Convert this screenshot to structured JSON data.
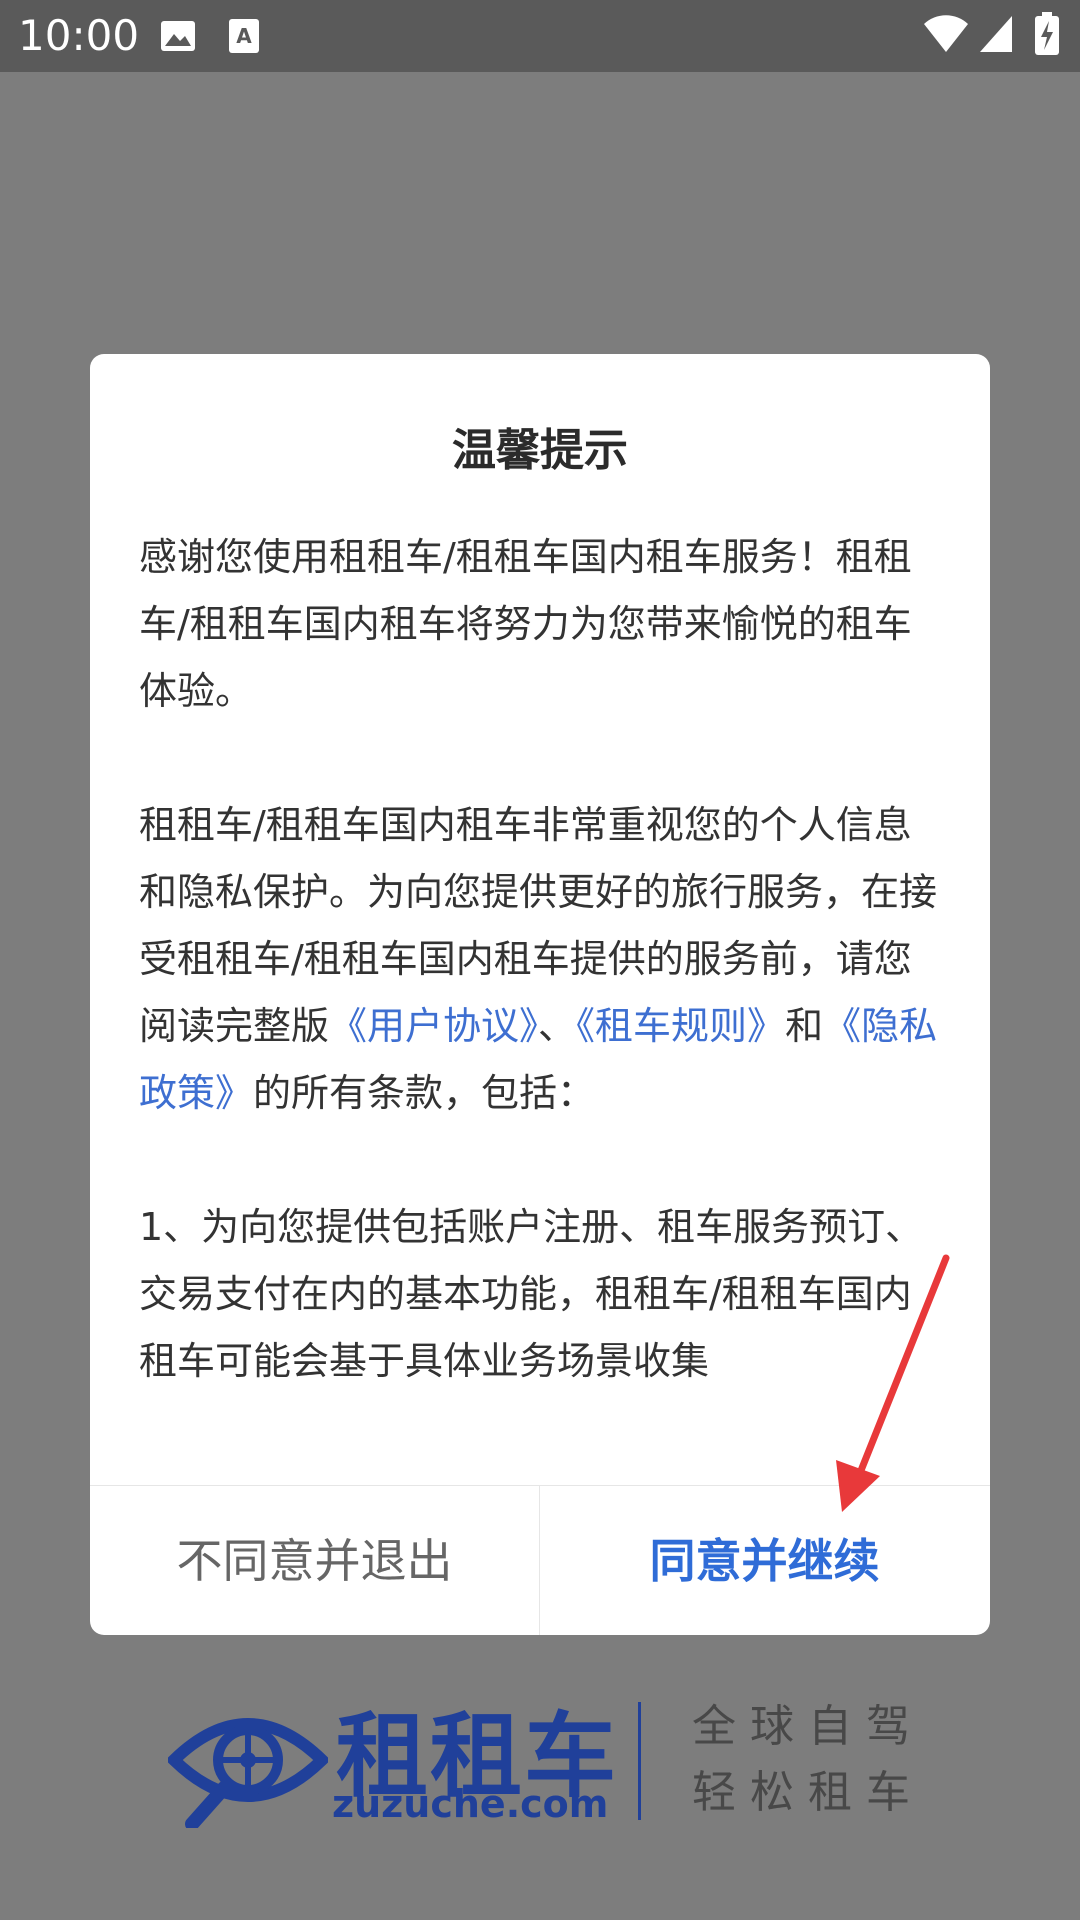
{
  "status_bar": {
    "time": "10:00",
    "icons": [
      "image-icon",
      "text-a-icon",
      "wifi-icon",
      "signal-icon",
      "battery-charging-icon"
    ]
  },
  "dialog": {
    "title": "温馨提示",
    "paragraphs": {
      "p1": "感谢您使用租租车/租租车国内租车服务！租租车/租租车国内租车将努力为您带来愉悦的租车体验。",
      "p2_part1": "租租车/租租车国内租车非常重视您的个人信息和隐私保护。为向您提供更好的旅行服务，在接受租租车/租租车国内租车提供的服务前，请您阅读完整版",
      "p2_link_user_agreement": "《用户协议》",
      "p2_sep1": "、",
      "p2_link_rental_rules": "《租车规则》",
      "p2_and": "和",
      "p2_link_privacy_policy": "《隐私政策》",
      "p2_part2": "的所有条款，包括：",
      "p3": "1、为向您提供包括账户注册、租车服务预订、交易支付在内的基本功能，租租车/租租车国内租车可能会基于具体业务场景收集"
    },
    "buttons": {
      "disagree": "不同意并退出",
      "agree": "同意并继续"
    }
  },
  "brand": {
    "name": "租租车",
    "url": "zuzuche.com",
    "slogan_line1": "全球自驾",
    "slogan_line2": "轻松租车"
  },
  "colors": {
    "overlay": "#7d7d7d",
    "status_bar": "#5a5a5a",
    "link": "#3e6fd1",
    "agree_button": "#2f6cd7",
    "brand": "#20409a",
    "annotation_arrow": "#e8393a"
  }
}
